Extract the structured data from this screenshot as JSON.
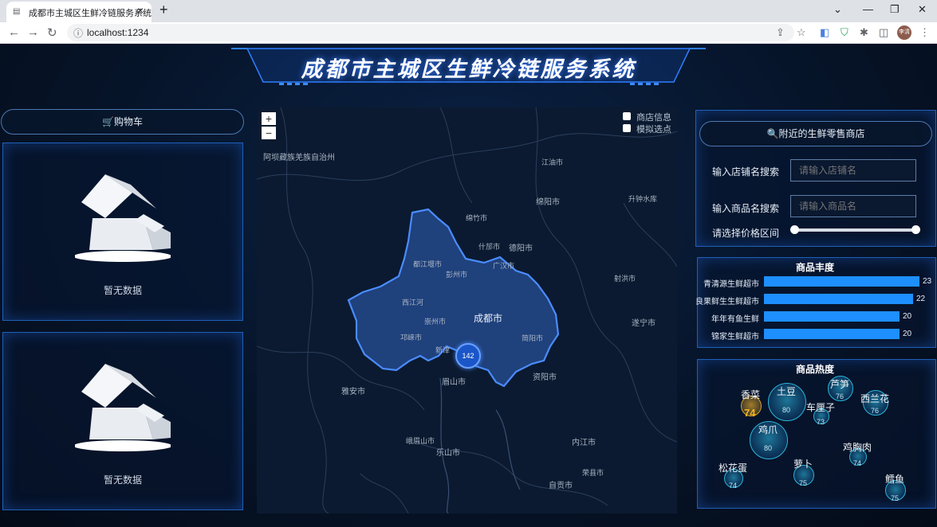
{
  "browser": {
    "tab_title": "成都市主城区生鲜冷链服务系统",
    "url": "localhost:1234",
    "profile_label": "李清"
  },
  "header": {
    "title": "成都市主城区生鲜冷链服务系统"
  },
  "cart": {
    "label": "🛒购物车"
  },
  "left_panels": [
    {
      "empty_text": "暂无数据"
    },
    {
      "empty_text": "暂无数据"
    }
  ],
  "map": {
    "zoom_in": "+",
    "zoom_out": "−",
    "layers": [
      {
        "label": "商店信息",
        "checked": false
      },
      {
        "label": "模拟选点",
        "checked": false
      }
    ],
    "cluster_count": "142",
    "places": {
      "aba": "阿坝藏族羌族自治州",
      "jiangyou": "江油市",
      "mianyang": "绵阳市",
      "mianzhu": "绵竹市",
      "shifang": "什邡市",
      "deyang": "德阳市",
      "guanghan": "广汉市",
      "dujiangyan": "都江堰市",
      "pengzhou": "彭州市",
      "sheng": "升钟水库",
      "xijiang": "西江河",
      "chongzhou": "崇州市",
      "qionglai": "邛崃市",
      "jianyang": "简阳市",
      "chengdu": "成都市",
      "shehong": "射洪市",
      "suining": "遂宁市",
      "pengshan": "眉山市",
      "yaan": "雅安市",
      "ziyang": "资阳市",
      "emei": "峨眉山市",
      "leshan": "乐山市",
      "neijiang": "内江市",
      "zigong": "自贡市",
      "rongxian": "荣县市",
      "minjiang": "新津"
    }
  },
  "search": {
    "title": "🔍附近的生鲜零售商店",
    "shop_label": "输入店铺名搜索",
    "shop_placeholder": "请输入店铺名",
    "goods_label": "输入商品名搜索",
    "goods_placeholder": "请输入商品名",
    "price_label": "请选择价格区间",
    "price_range": [
      0,
      1
    ]
  },
  "richness": {
    "title": "商品丰度",
    "stores": [
      {
        "name": "青清源生鲜超市",
        "value": 23
      },
      {
        "name": "良果鲜生生鲜超市",
        "value": 22
      },
      {
        "name": "年年有鱼生鲜",
        "value": 20
      },
      {
        "name": "锦家生鲜超市",
        "value": 20
      }
    ]
  },
  "heat": {
    "title": "商品热度",
    "items": [
      {
        "name": "土豆",
        "value": "80",
        "gold": false
      },
      {
        "name": "鸡爪",
        "value": "80",
        "gold": false
      },
      {
        "name": "芦笋",
        "value": "76",
        "gold": false
      },
      {
        "name": "西兰花",
        "value": "76",
        "gold": false
      },
      {
        "name": "香菜",
        "value": "74",
        "gold": true
      },
      {
        "name": "车厘子",
        "value": "73",
        "gold": false
      },
      {
        "name": "鸡胸肉",
        "value": "74",
        "gold": false
      },
      {
        "name": "萝卜",
        "value": "75",
        "gold": false
      },
      {
        "name": "松花蛋",
        "value": "74",
        "gold": false
      },
      {
        "name": "鳕鱼",
        "value": "75",
        "gold": false
      }
    ]
  }
}
